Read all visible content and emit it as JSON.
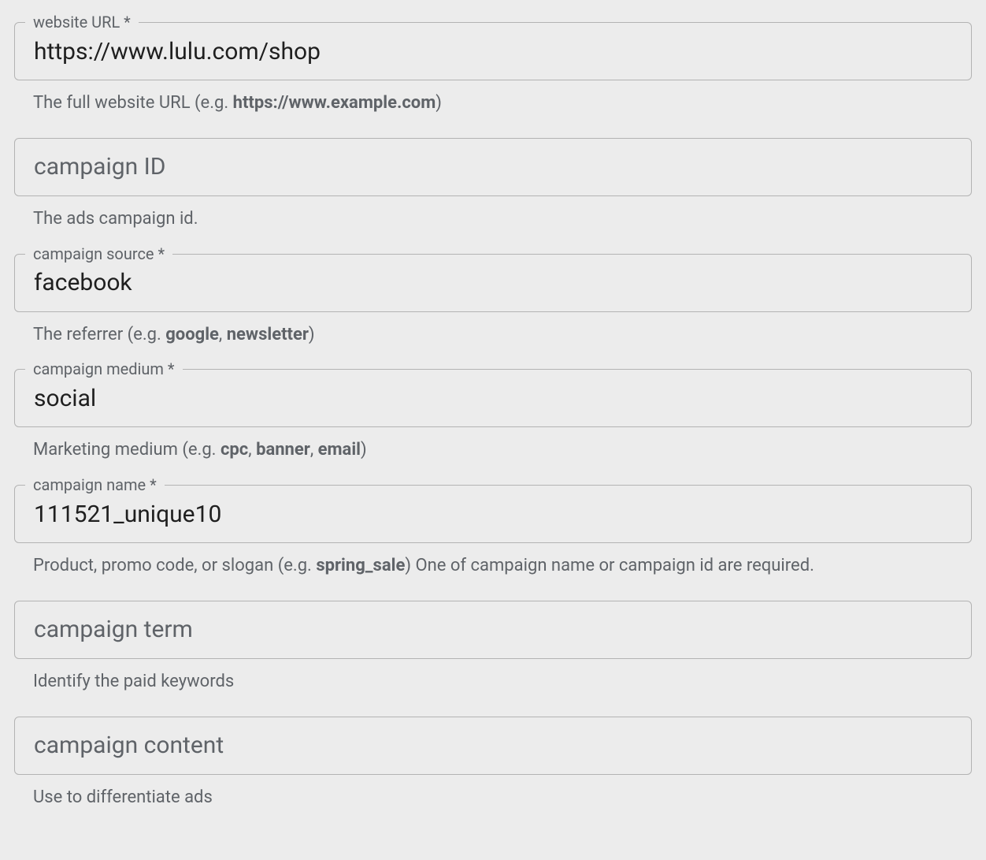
{
  "fields": {
    "websiteUrl": {
      "label": "website URL *",
      "value": "https://www.lulu.com/shop",
      "placeholder": "",
      "helpPrefix": "The full website URL (e.g. ",
      "helpBold1": "https://www.example.com",
      "helpSuffix": ")"
    },
    "campaignId": {
      "label": "",
      "value": "",
      "placeholder": "campaign ID",
      "help": "The ads campaign id."
    },
    "campaignSource": {
      "label": "campaign source *",
      "value": "facebook",
      "placeholder": "",
      "helpPrefix": "The referrer (e.g. ",
      "helpBold1": "google",
      "helpSep1": ", ",
      "helpBold2": "newsletter",
      "helpSuffix": ")"
    },
    "campaignMedium": {
      "label": "campaign medium *",
      "value": "social",
      "placeholder": "",
      "helpPrefix": "Marketing medium (e.g. ",
      "helpBold1": "cpc",
      "helpSep1": ", ",
      "helpBold2": "banner",
      "helpSep2": ", ",
      "helpBold3": "email",
      "helpSuffix": ")"
    },
    "campaignName": {
      "label": "campaign name *",
      "value": "111521_unique10",
      "placeholder": "",
      "helpPrefix": "Product, promo code, or slogan (e.g. ",
      "helpBold1": "spring_sale",
      "helpSuffix": ") One of campaign name or campaign id are required."
    },
    "campaignTerm": {
      "label": "",
      "value": "",
      "placeholder": "campaign term",
      "help": "Identify the paid keywords"
    },
    "campaignContent": {
      "label": "",
      "value": "",
      "placeholder": "campaign content",
      "help": "Use to differentiate ads"
    }
  }
}
